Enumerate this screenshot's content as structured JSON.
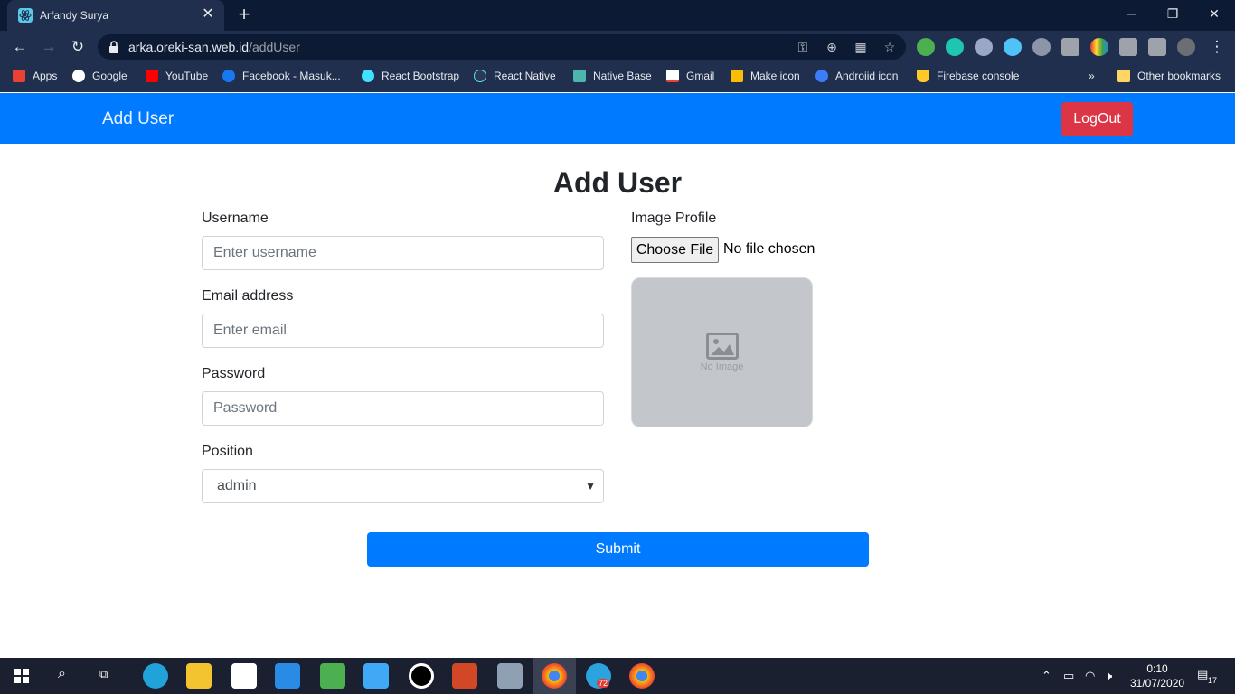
{
  "browser": {
    "tab_title": "Arfandy Surya",
    "url_host": "arka.oreki-san.web.id",
    "url_path": "/addUser",
    "bookmarks": [
      "Apps",
      "Google",
      "YouTube",
      "Facebook - Masuk...",
      "React Bootstrap",
      "React Native",
      "Native Base",
      "Gmail",
      "Make icon",
      "Androiid icon",
      "Firebase console",
      "Other bookmarks"
    ]
  },
  "navbar": {
    "brand": "Add User",
    "logout_label": "LogOut"
  },
  "form": {
    "title": "Add User",
    "username_label": "Username",
    "username_placeholder": "Enter username",
    "email_label": "Email address",
    "email_placeholder": "Enter email",
    "password_label": "Password",
    "password_placeholder": "Password",
    "position_label": "Position",
    "position_value": "admin",
    "image_label": "Image Profile",
    "choose_file_label": "Choose File",
    "no_file_text": "No file chosen",
    "no_image_text": "No Image",
    "submit_label": "Submit"
  },
  "taskbar": {
    "time": "0:10",
    "date": "31/07/2020",
    "notification_count": "17",
    "telegram_badge": "72"
  },
  "colors": {
    "primary": "#007bff",
    "danger": "#dc3545",
    "chrome_dark": "#0d1a33",
    "chrome_toolbar": "#1f2f4d"
  }
}
